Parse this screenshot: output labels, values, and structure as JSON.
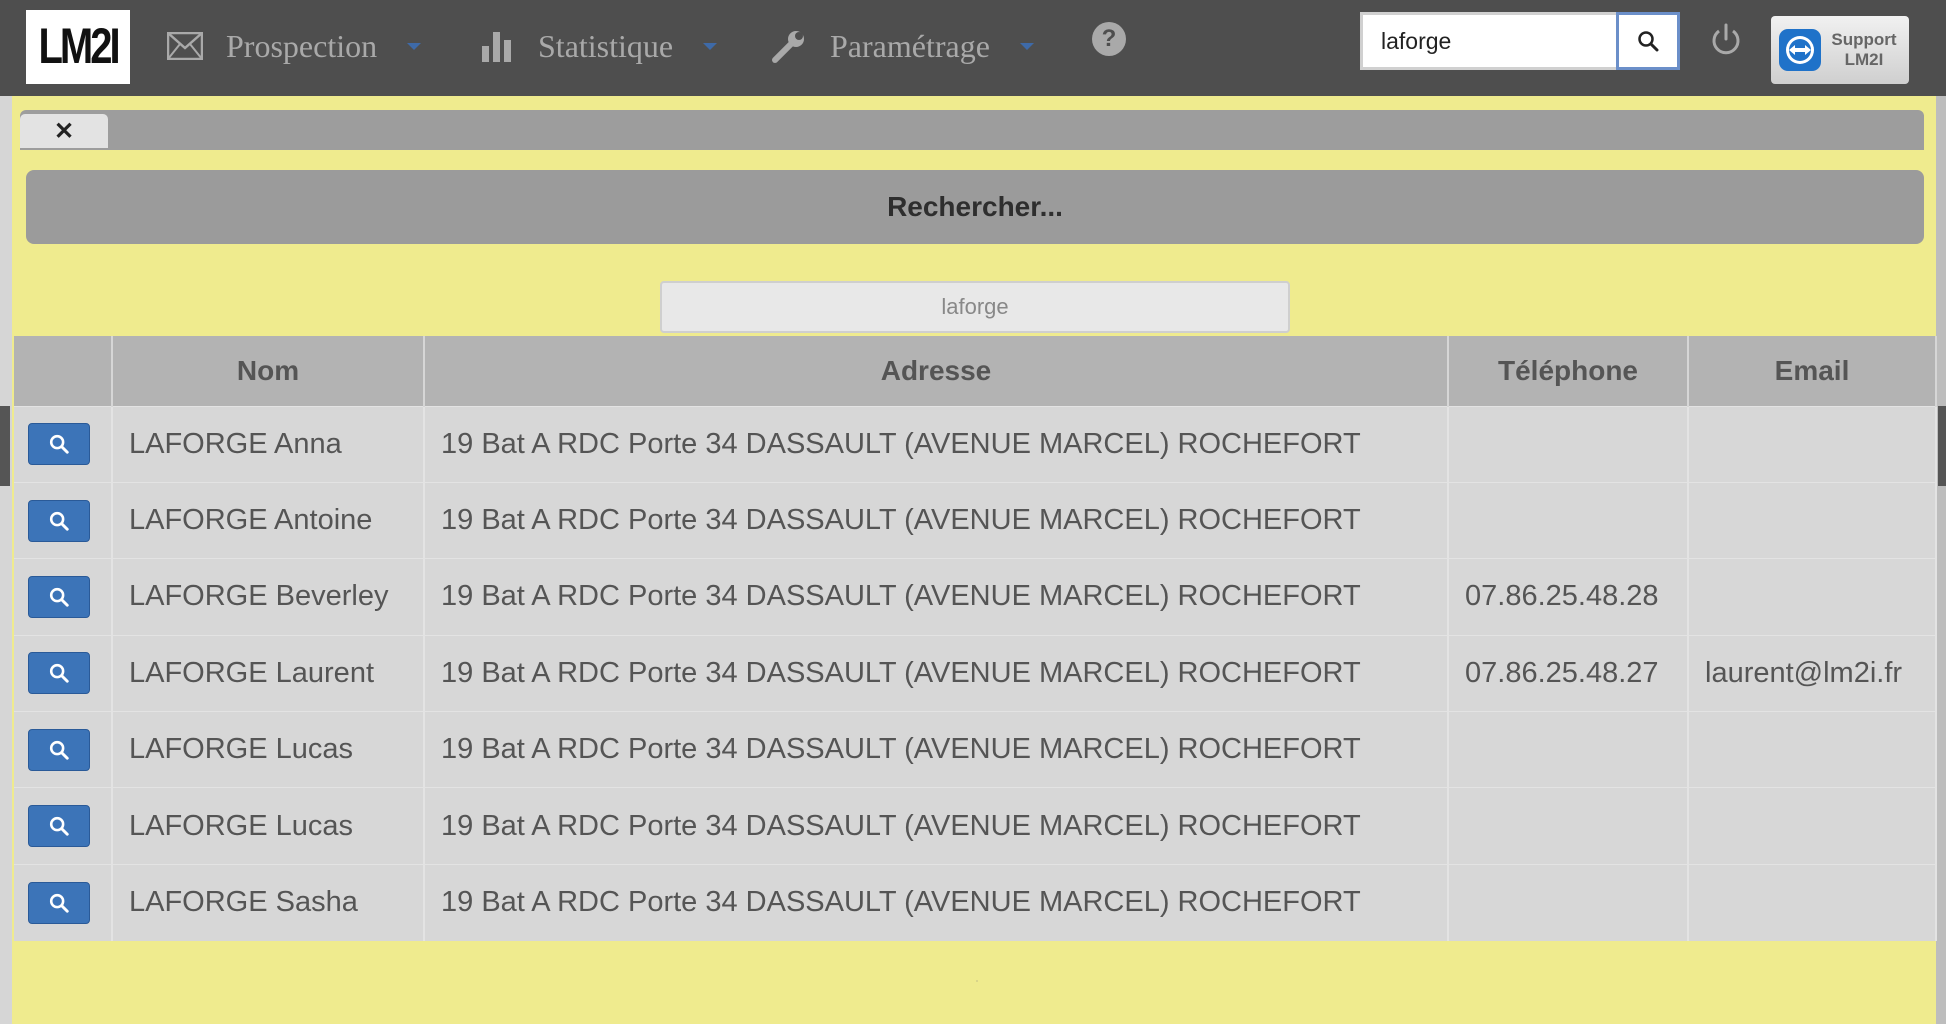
{
  "app": {
    "logo_text": "LM2I"
  },
  "nav": {
    "items": [
      {
        "label": "Prospection",
        "icon": "envelope-icon"
      },
      {
        "label": "Statistique",
        "icon": "bar-chart-icon"
      },
      {
        "label": "Paramétrage",
        "icon": "wrench-icon"
      }
    ],
    "help_glyph": "?"
  },
  "top_search": {
    "value": "laforge"
  },
  "support": {
    "label_line1": "Support",
    "label_line2": "LM2I"
  },
  "tab": {
    "close_glyph": "✕"
  },
  "search_panel": {
    "title": "Rechercher...",
    "filter_value": "laforge"
  },
  "table": {
    "headers": [
      "",
      "Nom",
      "Adresse",
      "Téléphone",
      "Email"
    ],
    "rows": [
      {
        "nom": "LAFORGE Anna",
        "adresse": "19 Bat A RDC Porte 34 DASSAULT (AVENUE MARCEL) ROCHEFORT",
        "telephone": "",
        "email": ""
      },
      {
        "nom": "LAFORGE Antoine",
        "adresse": "19 Bat A RDC Porte 34 DASSAULT (AVENUE MARCEL) ROCHEFORT",
        "telephone": "",
        "email": ""
      },
      {
        "nom": "LAFORGE Beverley",
        "adresse": "19 Bat A RDC Porte 34 DASSAULT (AVENUE MARCEL) ROCHEFORT",
        "telephone": "07.86.25.48.28",
        "email": ""
      },
      {
        "nom": "LAFORGE Laurent",
        "adresse": "19 Bat A RDC Porte 34 DASSAULT (AVENUE MARCEL) ROCHEFORT",
        "telephone": "07.86.25.48.27",
        "email": "laurent@lm2i.fr"
      },
      {
        "nom": "LAFORGE Lucas",
        "adresse": "19 Bat A RDC Porte 34 DASSAULT (AVENUE MARCEL) ROCHEFORT",
        "telephone": "",
        "email": ""
      },
      {
        "nom": "LAFORGE Lucas",
        "adresse": "19 Bat A RDC Porte 34 DASSAULT (AVENUE MARCEL) ROCHEFORT",
        "telephone": "",
        "email": ""
      },
      {
        "nom": "LAFORGE Sasha",
        "adresse": "19 Bat A RDC Porte 34 DASSAULT (AVENUE MARCEL) ROCHEFORT",
        "telephone": "",
        "email": ""
      }
    ]
  },
  "colors": {
    "topbar": "#4e4e4e",
    "content_bg": "#efeb8e",
    "button_blue": "#3c74b8",
    "header_gray": "#b3b3b3",
    "row_gray": "#d7d7d7"
  }
}
